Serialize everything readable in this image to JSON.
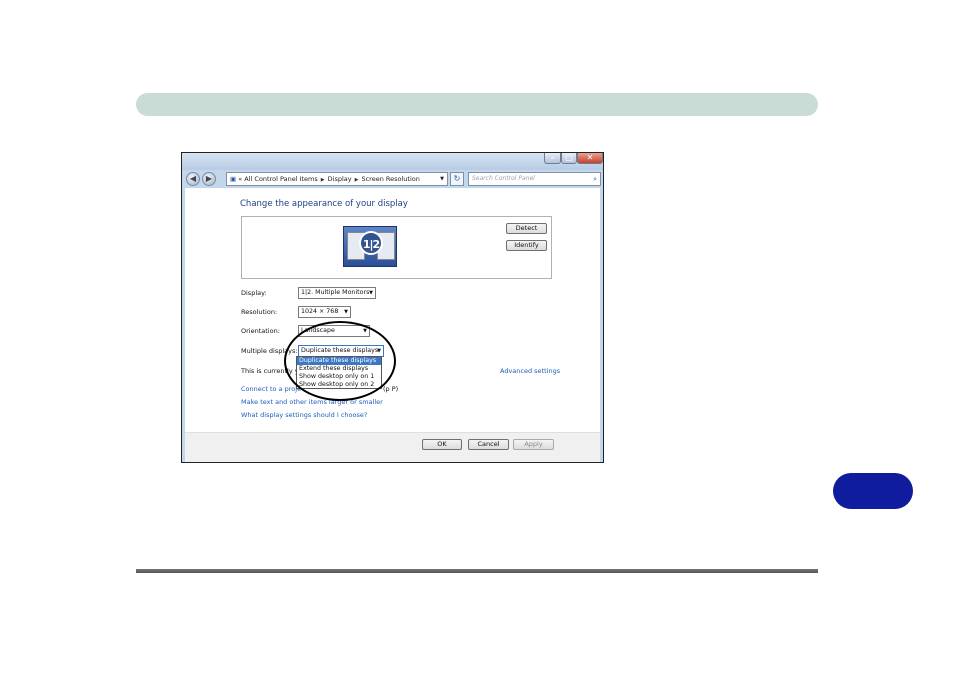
{
  "window": {
    "breadcrumb": [
      "All Control Panel Items",
      "Display",
      "Screen Resolution"
    ],
    "breadcrumb_prefix": "«",
    "search_placeholder": "Search Control Panel",
    "heading": "Change the appearance of your display",
    "monitor_label": "1|2",
    "detect_label": "Detect",
    "identify_label": "Identify",
    "display_label": "Display:",
    "display_value": "1|2. Multiple Monitors",
    "resolution_label": "Resolution:",
    "resolution_value": "1024 × 768",
    "orientation_label": "Orientation:",
    "orientation_value": "Landscape",
    "multiple_label": "Multiple displays:",
    "multiple_value": "Duplicate these displays",
    "multiple_options": [
      "Duplicate these displays",
      "Extend these displays",
      "Show desktop only on 1",
      "Show desktop only on 2"
    ],
    "current_text": "This is currently you",
    "advanced_link": "Advanced settings",
    "connect_link_start": "Connect to a proje",
    "connect_link_end": "(p P)",
    "text_size_link": "Make text and other items larger or smaller",
    "help_link": "What display settings should I choose?",
    "ok_label": "OK",
    "cancel_label": "Cancel",
    "apply_label": "Apply"
  },
  "colors": {
    "header_bar": "#c9dcd6",
    "chapter_tab": "#0f1c9e",
    "link": "#1f5cbf",
    "heading": "#1e3f87"
  }
}
